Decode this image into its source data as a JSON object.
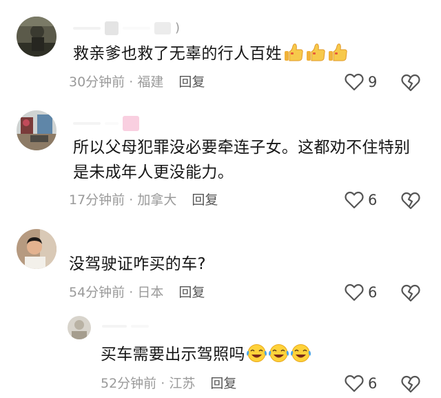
{
  "comments": [
    {
      "text": "救亲爹也救了无辜的行人百姓",
      "emoji": [
        "thumbs-up-icon",
        "thumbs-up-icon",
        "thumbs-up-icon"
      ],
      "time": "30分钟前",
      "location": "福建",
      "reply_label": "回复",
      "likes": "9",
      "username_suffix": ")"
    },
    {
      "text_line1": "所以父母犯罪没必要牵连子女。这都劝不住特别",
      "text_line2": "是未成年人更没能力。",
      "time": "17分钟前",
      "location": "加拿大",
      "reply_label": "回复",
      "likes": "6"
    },
    {
      "text": "没驾驶证咋买的车?",
      "time": "54分钟前",
      "location": "日本",
      "reply_label": "回复",
      "likes": "6"
    },
    {
      "text": "买车需要出示驾照吗",
      "emoji": [
        "laughing-crying-face-icon",
        "laughing-crying-face-icon",
        "laughing-crying-face-icon"
      ],
      "time": "52分钟前",
      "location": "江苏",
      "reply_label": "回复",
      "likes": "6"
    }
  ],
  "separator": " · ",
  "colors": {
    "text": "#161616",
    "meta": "#9a9a9a",
    "icon": "#555555"
  }
}
